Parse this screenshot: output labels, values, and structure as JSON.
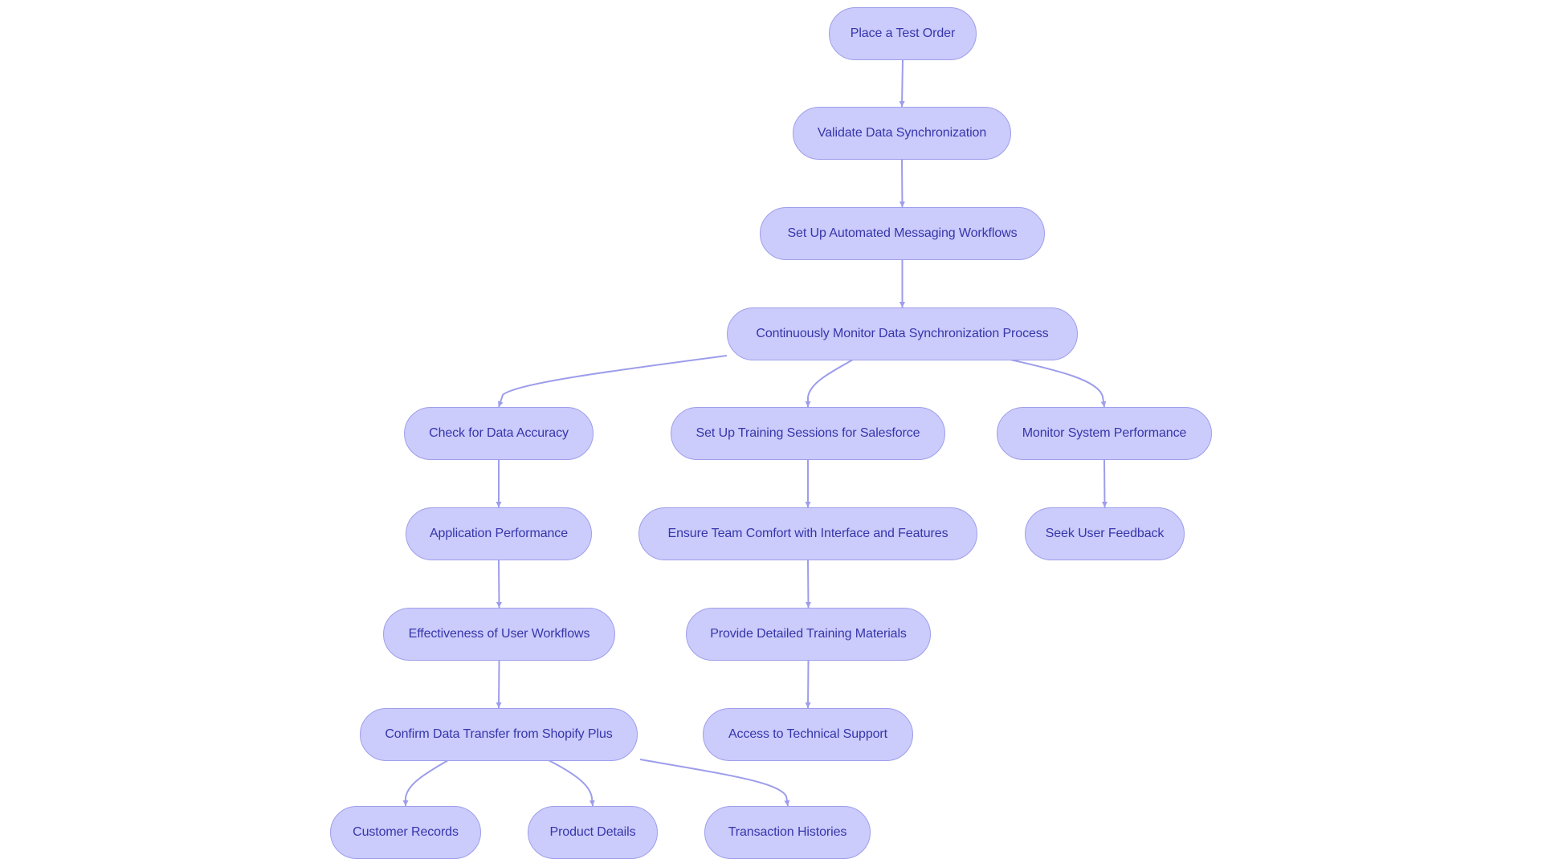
{
  "diagram": {
    "type": "flowchart",
    "direction": "top-down",
    "colors": {
      "node_fill": "#cbcbfc",
      "node_border": "#9f9fea",
      "node_text": "#3636aa",
      "edge": "#9d9deb",
      "background": "#ffffff"
    },
    "nodes": [
      {
        "id": "place_test_order",
        "label": "Place a Test Order"
      },
      {
        "id": "validate_data_sync",
        "label": "Validate Data Synchronization"
      },
      {
        "id": "automated_messaging",
        "label": "Set Up Automated Messaging Workflows"
      },
      {
        "id": "monitor_sync_process",
        "label": "Continuously Monitor Data Synchronization Process"
      },
      {
        "id": "check_data_accuracy",
        "label": "Check for Data Accuracy"
      },
      {
        "id": "training_sessions",
        "label": "Set Up Training Sessions for Salesforce"
      },
      {
        "id": "monitor_system_performance",
        "label": "Monitor System Performance"
      },
      {
        "id": "application_performance",
        "label": "Application Performance"
      },
      {
        "id": "team_comfort",
        "label": "Ensure Team Comfort with Interface and Features"
      },
      {
        "id": "seek_user_feedback",
        "label": "Seek User Feedback"
      },
      {
        "id": "user_workflows",
        "label": "Effectiveness of User Workflows"
      },
      {
        "id": "training_materials",
        "label": "Provide Detailed Training Materials"
      },
      {
        "id": "confirm_data_transfer",
        "label": "Confirm Data Transfer from Shopify Plus"
      },
      {
        "id": "technical_support",
        "label": "Access to Technical Support"
      },
      {
        "id": "customer_records",
        "label": "Customer Records"
      },
      {
        "id": "product_details",
        "label": "Product Details"
      },
      {
        "id": "transaction_histories",
        "label": "Transaction Histories"
      }
    ],
    "edges": [
      {
        "from": "place_test_order",
        "to": "validate_data_sync"
      },
      {
        "from": "validate_data_sync",
        "to": "automated_messaging"
      },
      {
        "from": "automated_messaging",
        "to": "monitor_sync_process"
      },
      {
        "from": "monitor_sync_process",
        "to": "check_data_accuracy"
      },
      {
        "from": "monitor_sync_process",
        "to": "training_sessions"
      },
      {
        "from": "monitor_sync_process",
        "to": "monitor_system_performance"
      },
      {
        "from": "check_data_accuracy",
        "to": "application_performance"
      },
      {
        "from": "application_performance",
        "to": "user_workflows"
      },
      {
        "from": "user_workflows",
        "to": "confirm_data_transfer"
      },
      {
        "from": "training_sessions",
        "to": "team_comfort"
      },
      {
        "from": "team_comfort",
        "to": "training_materials"
      },
      {
        "from": "training_materials",
        "to": "technical_support"
      },
      {
        "from": "monitor_system_performance",
        "to": "seek_user_feedback"
      },
      {
        "from": "confirm_data_transfer",
        "to": "customer_records"
      },
      {
        "from": "confirm_data_transfer",
        "to": "product_details"
      },
      {
        "from": "confirm_data_transfer",
        "to": "transaction_histories"
      }
    ]
  }
}
